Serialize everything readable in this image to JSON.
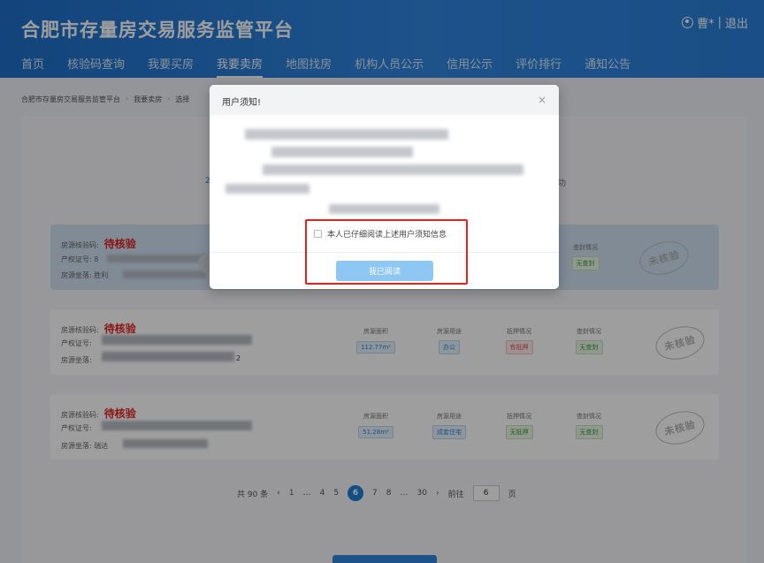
{
  "header": {
    "title": "合肥市存量房交易服务监管平台",
    "user": "曹*",
    "separator": "|",
    "logout": "退出"
  },
  "nav": [
    {
      "label": "首页"
    },
    {
      "label": "核验码查询"
    },
    {
      "label": "我要买房"
    },
    {
      "label": "我要卖房",
      "active": true
    },
    {
      "label": "地图找房"
    },
    {
      "label": "机构人员公示"
    },
    {
      "label": "信用公示"
    },
    {
      "label": "评价排行"
    },
    {
      "label": "通知公告"
    }
  ],
  "breadcrumb": [
    "合肥市存量房交易服务监管平台",
    "我要卖房",
    "选择"
  ],
  "steps": {
    "left_fragment": "2",
    "right_fragment": "成功"
  },
  "cards": [
    {
      "verify_label": "房源核验码:",
      "status": "待核验",
      "cert_label": "产权证号:",
      "cert_visible": "8",
      "location_label": "房源坐落:",
      "location_visible": "胜利",
      "seal_label": "查封情况",
      "seal_value": "无查封",
      "stamp": "未核验"
    },
    {
      "verify_label": "房源核验码:",
      "status": "待核验",
      "cert_label": "产权证号:",
      "location_label": "房源坐落:",
      "location_tail": "2",
      "area_label": "房源面积",
      "area_value": "112.77m²",
      "usage_label": "房源用途",
      "usage_value": "办公",
      "mortgage_label": "抵押情况",
      "mortgage_value": "有抵押",
      "seal_label": "查封情况",
      "seal_value": "无查封",
      "stamp": "未核验"
    },
    {
      "verify_label": "房源核验码:",
      "status": "待核验",
      "cert_label": "产权证号:",
      "location_label": "房源坐落:",
      "location_visible": "瑞达",
      "area_label": "房源面积",
      "area_value": "51.28m²",
      "usage_label": "房源用途",
      "usage_value": "成套住宅",
      "mortgage_label": "抵押情况",
      "mortgage_value": "无抵押",
      "seal_label": "查封情况",
      "seal_value": "无查封",
      "stamp": "未核验"
    }
  ],
  "pagination": {
    "total_prefix": "共",
    "total": "90",
    "total_suffix": "条",
    "prev": "‹",
    "next": "›",
    "pages": [
      "1",
      "…",
      "4",
      "5",
      "6",
      "7",
      "8",
      "…",
      "30"
    ],
    "current": "6",
    "goto_label": "前往",
    "goto_value": "6",
    "page_suffix": "页"
  },
  "modal": {
    "title": "用户须知!",
    "close": "×",
    "agree_text": "本人已仔细阅读上述用户须知信息",
    "confirm": "我已阅读"
  },
  "colors": {
    "header_blue": "#2f86de",
    "status_red": "#e02020",
    "highlight_box": "#e8231e",
    "confirm_button": "#8ec6f4"
  }
}
